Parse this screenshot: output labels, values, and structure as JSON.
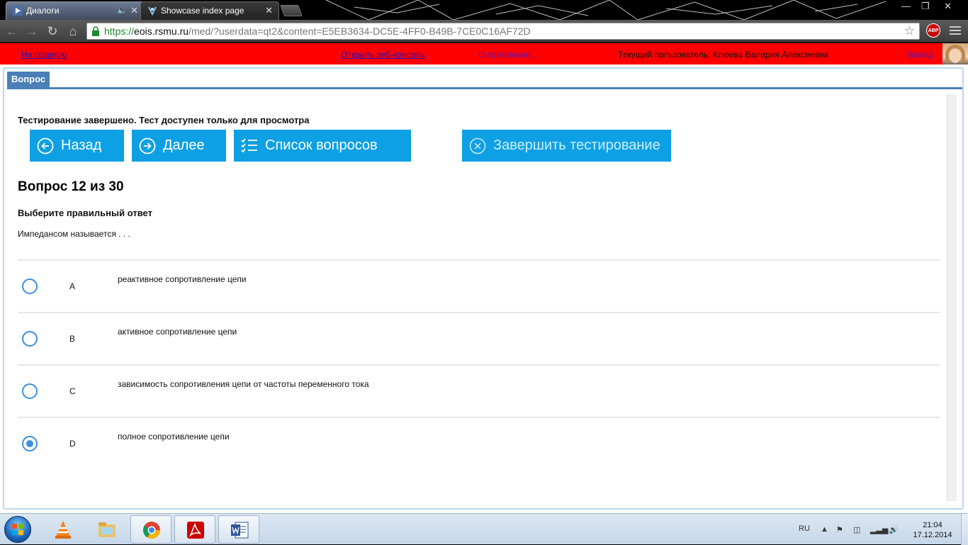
{
  "browser": {
    "tabs": [
      {
        "label": "Диалоги",
        "icon": "media-player-icon",
        "active": false
      },
      {
        "label": "Showcase index page",
        "icon": "page-icon",
        "active": true
      }
    ],
    "address": {
      "scheme": "https://",
      "host": "eois.rsmu.ru",
      "path": "/med/?userdata=qt2&content=E5EB3634-DC5E-4FF0-B49B-7CE0C16AF72D"
    },
    "extension_badge": "ABP"
  },
  "appbar": {
    "home_link": "На главную",
    "console_link": "Открыть веб-консоль",
    "about_link": "О программе...",
    "current_user": "Текущий пользователь: Клюева Валерия Алексеевна",
    "logout_link": "Выход"
  },
  "panel": {
    "tab_label": "Вопрос",
    "status_text": "Тестирование завершено. Тест доступен только для просмотра",
    "buttons": {
      "back": "Назад",
      "next": "Далее",
      "list": "Список вопросов",
      "finish": "Завершить тестирование"
    },
    "question_title": "Вопрос 12 из 30",
    "prompt": "Выберите правильный ответ",
    "question_text": "Импедансом называется . . .",
    "answers": [
      {
        "letter": "A",
        "text": "реактивное сопротивление цепи",
        "selected": false
      },
      {
        "letter": "B",
        "text": "активное сопротивление цепи",
        "selected": false
      },
      {
        "letter": "C",
        "text": "зависимость сопротивления цепи от частоты переменного тока",
        "selected": false
      },
      {
        "letter": "D",
        "text": "полное сопротивление цепи",
        "selected": true
      }
    ]
  },
  "taskbar": {
    "apps": [
      "vlc-icon",
      "file-explorer-icon",
      "chrome-icon",
      "acrobat-icon",
      "word-icon"
    ],
    "language": "RU",
    "time": "21:04",
    "date": "17.12.2014"
  },
  "colors": {
    "appbar_bg": "#ff0000",
    "button_bg": "#0ea0e4",
    "tab_accent": "#4a7fb8",
    "radio": "#3a8fe0"
  }
}
